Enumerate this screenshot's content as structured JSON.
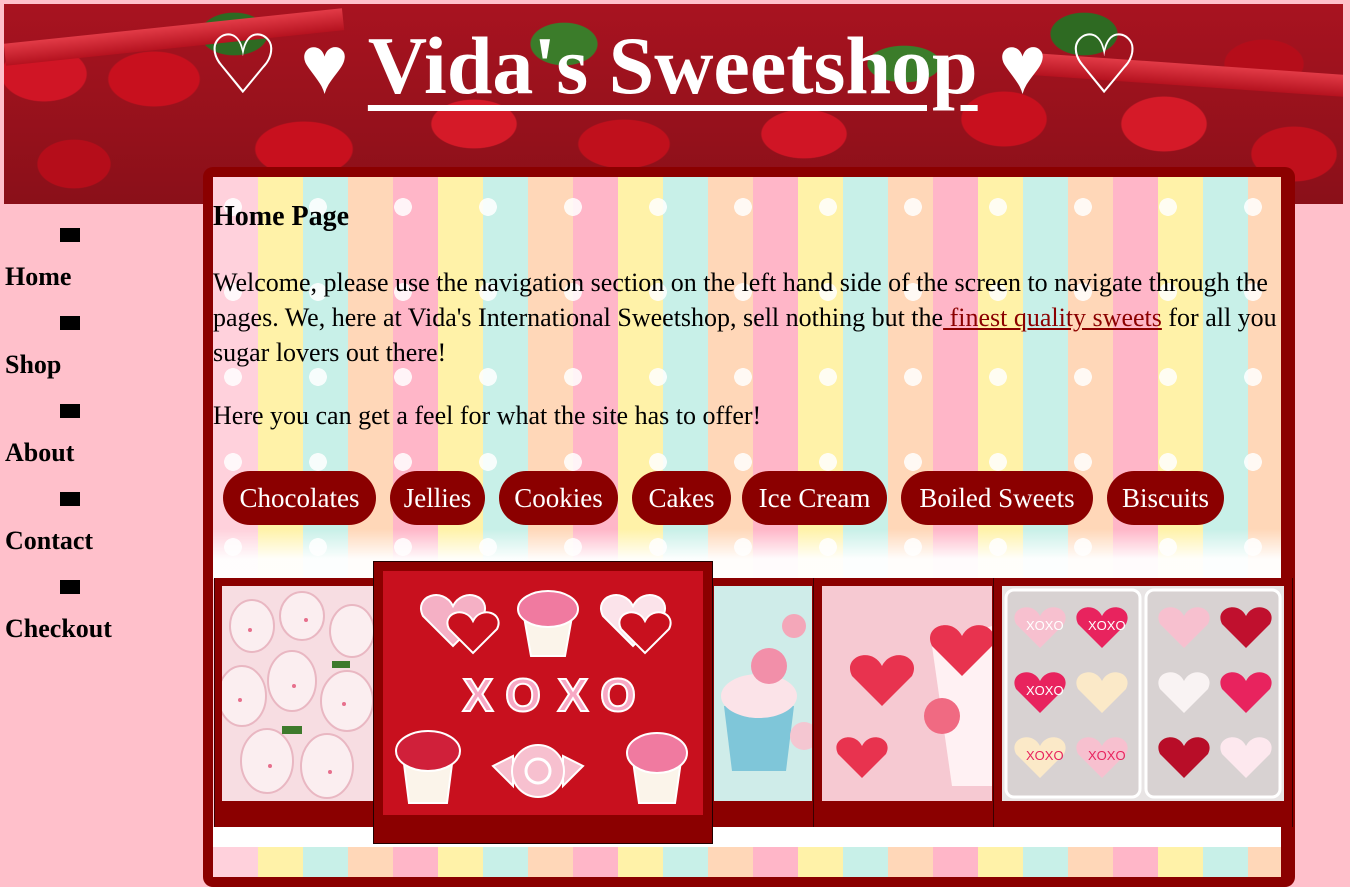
{
  "header": {
    "title_prefix": "♡ ♥ ",
    "title": "Vida's Sweetshop",
    "title_suffix": " ♥ ♡"
  },
  "nav": {
    "items": [
      {
        "label": "Home"
      },
      {
        "label": "Shop"
      },
      {
        "label": "About"
      },
      {
        "label": "Contact"
      },
      {
        "label": "Checkout"
      }
    ]
  },
  "main": {
    "heading": "Home Page",
    "welcome_before": "Welcome, please use the navigation section on the left hand side of the screen to navigate through the pages. We, here at Vida's International Sweetshop, sell nothing but the",
    "welcome_link": " finest quality sweets",
    "welcome_after": " for all you sugar lovers out there!",
    "intro": "Here you can get a feel for what the site has to offer!",
    "categories": [
      "Chocolates",
      "Jellies",
      "Cookies",
      "Cakes",
      "Ice Cream",
      "Boiled Sweets",
      "Biscuits"
    ]
  },
  "gallery": {
    "images": [
      "chocolate-covered-strawberries",
      "xoxo-cookies",
      "rose-cupcakes",
      "heart-jellies",
      "heart-biscuits"
    ],
    "cookie_text": [
      "X",
      "O",
      "X",
      "O"
    ],
    "biscuit_text": [
      "XOXO",
      "XOXO",
      "XOXO",
      "XOXO",
      "XOXO"
    ]
  },
  "colors": {
    "page_bg": "#ffc0cb",
    "panel_border": "#8b0000",
    "pill_bg": "#8b0000",
    "pill_text": "#ffffff",
    "link": "#8b0000"
  }
}
